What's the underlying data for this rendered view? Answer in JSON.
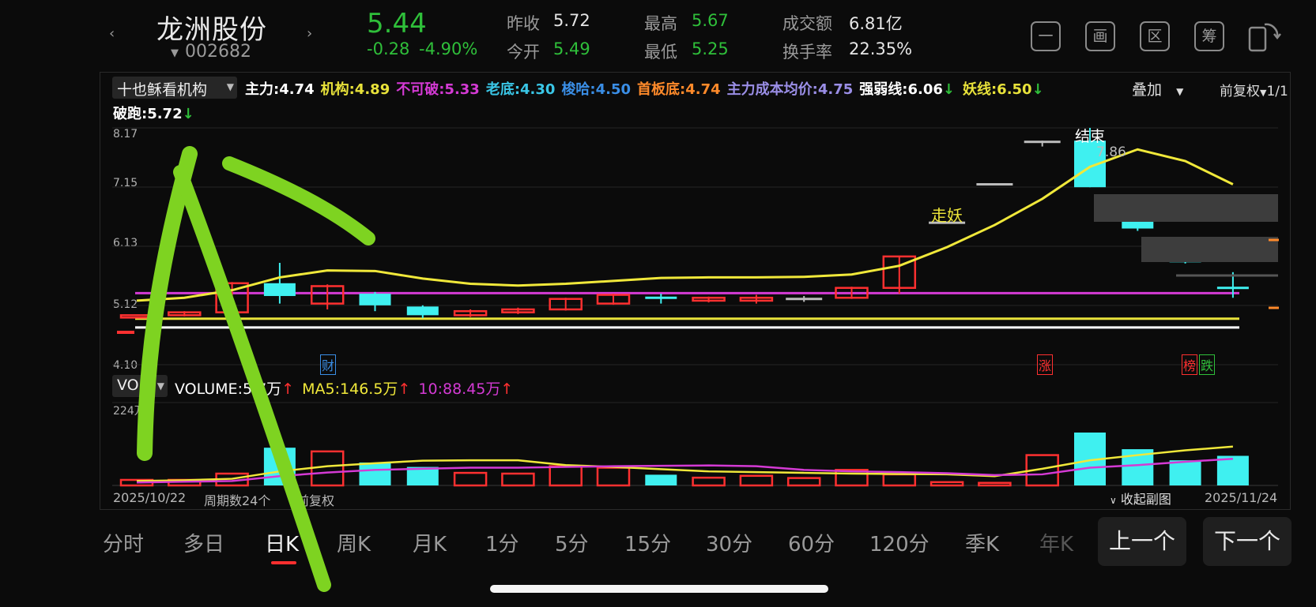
{
  "header": {
    "prev_arrow": "‹",
    "next_arrow": "›",
    "name": "龙洲股份",
    "code": "002682",
    "price": "5.44",
    "change": "-0.28",
    "change_pct": "-4.90%",
    "quote": [
      {
        "label": "昨收",
        "value": "5.72"
      },
      {
        "label": "今开",
        "value": "5.49"
      },
      {
        "label": "最高",
        "value": "5.67"
      },
      {
        "label": "最低",
        "value": "5.25"
      },
      {
        "label": "成交额",
        "value": "6.81亿"
      },
      {
        "label": "换手率",
        "value": "22.35%"
      }
    ],
    "tools": [
      "一",
      "画",
      "区",
      "筹"
    ]
  },
  "indicator_bar": {
    "selector": "十也稣看机构",
    "items": [
      {
        "label": "主力:4.74",
        "color": "#ffffff"
      },
      {
        "label": "机构:4.89",
        "color": "#e8e23a"
      },
      {
        "label": "不可破:5.33",
        "color": "#d43ad4"
      },
      {
        "label": "老底:4.30",
        "color": "#3ac6e6"
      },
      {
        "label": "梭哈:4.50",
        "color": "#3a8ee6"
      },
      {
        "label": "首板底:4.74",
        "color": "#ff8a2a"
      },
      {
        "label": "主力成本均价:4.75",
        "color": "#9a8ee6"
      },
      {
        "label": "强弱线:6.06",
        "color": "#ffffff"
      },
      {
        "label": "妖线:6.50",
        "color": "#e8e23a"
      }
    ],
    "overlay": "叠加",
    "adjust": "前复权",
    "page": "1/1",
    "second_line": "破跑:5.72"
  },
  "price_axis": [
    "8.17",
    "7.15",
    "6.13",
    "5.12",
    "4.10"
  ],
  "annotations": {
    "top_label": "结束",
    "top_value": "7.86",
    "demon_walk": "走妖",
    "cai": "财",
    "zhang": "涨",
    "bang": "榜",
    "die": "跌"
  },
  "volume_bar": {
    "selector": "VOL",
    "volume": "VOLUME:",
    "volume_value": "5.7万",
    "ma5": "MA5:146.5万",
    "ma10": "10:88.45万",
    "axis_top": "224",
    "axis_unit": "万"
  },
  "footer": {
    "start_date": "2025/10/22",
    "period_count": "周期数24个",
    "adjust": "前复权",
    "collapse": "收起副图",
    "end_date": "2025/11/24"
  },
  "tabs": [
    "分时",
    "多日",
    "日K",
    "周K",
    "月K",
    "1分",
    "5分",
    "15分",
    "30分",
    "60分",
    "120分",
    "季K",
    "年K"
  ],
  "nav": {
    "prev": "上一个",
    "next": "下一个"
  },
  "chart_data": {
    "type": "candlestick",
    "ylim": [
      4.1,
      8.17
    ],
    "colors": {
      "up": "#ff3030",
      "down": "#3ff0f0",
      "flat": "#bdbdbd",
      "ma": "#f0e83a",
      "line": "#d43ad4"
    },
    "candles": [
      {
        "o": 4.95,
        "c": 4.95,
        "h": 4.95,
        "l": 4.95,
        "d": "up"
      },
      {
        "o": 4.95,
        "c": 5.0,
        "h": 5.02,
        "l": 4.93,
        "d": "up"
      },
      {
        "o": 5.0,
        "c": 5.5,
        "h": 5.52,
        "l": 4.98,
        "d": "up"
      },
      {
        "o": 5.5,
        "c": 5.28,
        "h": 5.85,
        "l": 5.15,
        "d": "down"
      },
      {
        "o": 5.15,
        "c": 5.45,
        "h": 5.48,
        "l": 5.05,
        "d": "up"
      },
      {
        "o": 5.32,
        "c": 5.12,
        "h": 5.35,
        "l": 5.02,
        "d": "down"
      },
      {
        "o": 5.1,
        "c": 4.95,
        "h": 5.12,
        "l": 4.9,
        "d": "down"
      },
      {
        "o": 4.95,
        "c": 5.02,
        "h": 5.05,
        "l": 4.92,
        "d": "up"
      },
      {
        "o": 5.0,
        "c": 5.05,
        "h": 5.08,
        "l": 4.97,
        "d": "up"
      },
      {
        "o": 5.05,
        "c": 5.23,
        "h": 5.25,
        "l": 5.03,
        "d": "up"
      },
      {
        "o": 5.15,
        "c": 5.3,
        "h": 5.32,
        "l": 5.13,
        "d": "up"
      },
      {
        "o": 5.27,
        "c": 5.23,
        "h": 5.32,
        "l": 5.15,
        "d": "down"
      },
      {
        "o": 5.2,
        "c": 5.25,
        "h": 5.27,
        "l": 5.17,
        "d": "up"
      },
      {
        "o": 5.2,
        "c": 5.25,
        "h": 5.3,
        "l": 5.15,
        "d": "up"
      },
      {
        "o": 5.25,
        "c": 5.25,
        "h": 5.28,
        "l": 5.18,
        "d": "flat"
      },
      {
        "o": 5.25,
        "c": 5.42,
        "h": 5.44,
        "l": 5.23,
        "d": "up"
      },
      {
        "o": 5.42,
        "c": 5.96,
        "h": 5.96,
        "l": 5.32,
        "d": "up"
      },
      {
        "o": 6.56,
        "c": 6.56,
        "h": 6.56,
        "l": 6.56,
        "d": "flat"
      },
      {
        "o": 7.22,
        "c": 7.22,
        "h": 7.22,
        "l": 7.22,
        "d": "flat"
      },
      {
        "o": 7.95,
        "c": 7.95,
        "h": 7.95,
        "l": 7.85,
        "d": "flat"
      },
      {
        "o": 7.95,
        "c": 7.15,
        "h": 8.17,
        "l": 7.15,
        "d": "down"
      },
      {
        "o": 6.65,
        "c": 6.44,
        "h": 6.7,
        "l": 6.4,
        "d": "down"
      },
      {
        "o": 5.9,
        "c": 5.88,
        "h": 6.06,
        "l": 5.84,
        "d": "down"
      },
      {
        "o": 5.44,
        "c": 5.44,
        "h": 5.69,
        "l": 5.25,
        "d": "down"
      }
    ],
    "ma_line": [
      5.2,
      5.25,
      5.38,
      5.6,
      5.72,
      5.71,
      5.58,
      5.49,
      5.46,
      5.49,
      5.54,
      5.59,
      5.6,
      5.6,
      5.61,
      5.65,
      5.8,
      6.12,
      6.5,
      6.95,
      7.5,
      7.8,
      7.6,
      7.2
    ],
    "ma_line_extra": [
      6.72
    ],
    "horizontal_lines": [
      {
        "value": 5.33,
        "color": "#d43ad4"
      },
      {
        "value": 4.89,
        "color": "#e8e23a"
      },
      {
        "value": 4.74,
        "color": "#ffffff"
      }
    ],
    "volume": {
      "max": 224,
      "bars": [
        15,
        15,
        32,
        102,
        92,
        62,
        50,
        34,
        32,
        52,
        48,
        29,
        21,
        26,
        20,
        42,
        30,
        9,
        7,
        82,
        143,
        98,
        68,
        80
      ],
      "ma5": [
        12,
        14,
        18,
        38,
        52,
        60,
        67,
        68,
        68,
        55,
        50,
        44,
        38,
        36,
        34,
        32,
        31,
        30,
        25,
        45,
        68,
        82,
        95,
        105
      ],
      "ma10": [
        8,
        10,
        12,
        25,
        35,
        42,
        45,
        48,
        48,
        50,
        52,
        53,
        54,
        52,
        42,
        38,
        36,
        33,
        28,
        30,
        48,
        55,
        64,
        72
      ]
    }
  }
}
